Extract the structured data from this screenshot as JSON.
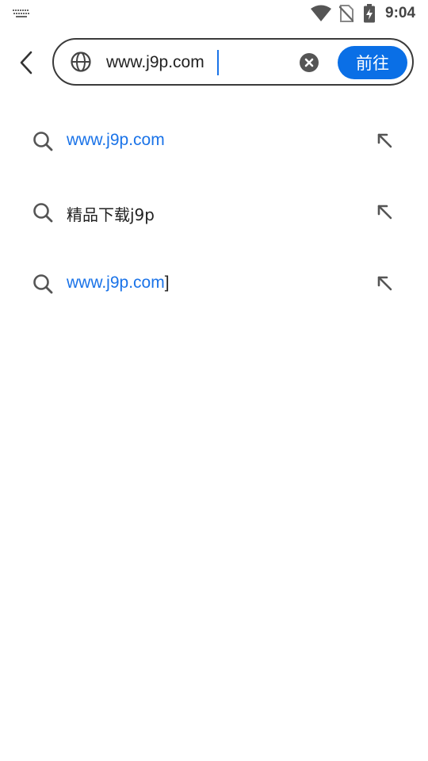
{
  "status_bar": {
    "time": "9:04",
    "icons": [
      "keyboard-icon",
      "wifi-icon",
      "no-sim-icon",
      "battery-charging-icon"
    ]
  },
  "search_bar": {
    "url_value": "www.j9p.com",
    "go_label": "前往",
    "icons": [
      "back-arrow-icon",
      "globe-icon",
      "clear-icon"
    ],
    "accent_color": "#0a6fe6"
  },
  "suggestions": [
    {
      "text": "www.j9p.com",
      "style": "link"
    },
    {
      "text": "精品下载j9p",
      "style": "plain"
    },
    {
      "text": "www.j9p.com",
      "suffix": "]",
      "style": "link"
    }
  ],
  "colors": {
    "link": "#1a73e8",
    "text": "#222222",
    "icon": "#555555"
  }
}
